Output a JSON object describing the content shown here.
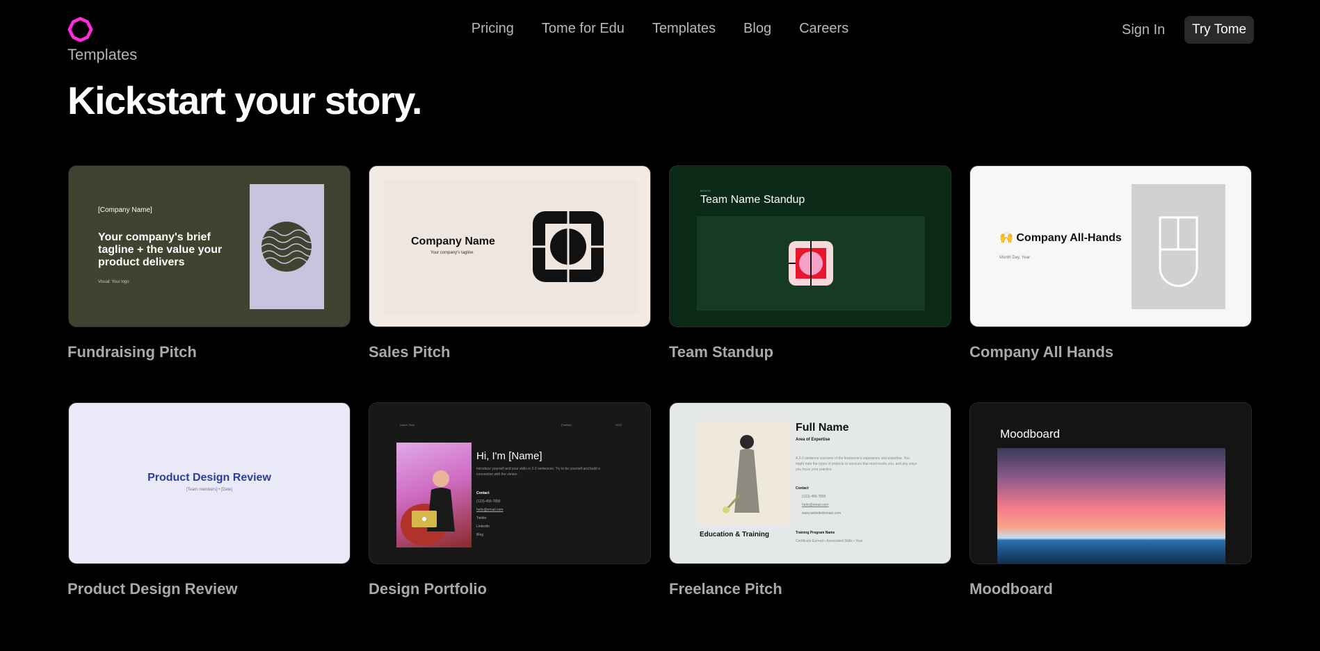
{
  "header": {
    "page_label": "Templates",
    "nav": [
      "Pricing",
      "Tome for Edu",
      "Templates",
      "Blog",
      "Careers"
    ],
    "sign_in": "Sign In",
    "try_button": "Try Tome"
  },
  "hero": "Kickstart your story.",
  "colors": {
    "logo": "#ff2bdd",
    "background": "#000000"
  },
  "cards": [
    {
      "title": "Fundraising Pitch",
      "company": "[Company Name]",
      "tagline": "Your company's brief tagline + the value your product delivers",
      "visual_note": "Visual: Your logo"
    },
    {
      "title": "Sales Pitch",
      "company": "Company Name",
      "tagline": "Your company's tagline"
    },
    {
      "title": "Team Standup",
      "heading": "Team Name Standup",
      "small": "MONTH"
    },
    {
      "title": "Company All Hands",
      "heading": "🙌 Company All-Hands",
      "date": "Month Day, Year"
    },
    {
      "title": "Product Design Review",
      "heading": "Product Design Review",
      "sub": "[Team members] • [Date]"
    },
    {
      "title": "Design Portfolio",
      "top_left": "Name, Role",
      "top_mid": "Portfolio",
      "top_right": "2023",
      "heading": "Hi, I'm [Name]",
      "intro": "Introduce yourself and your skills in 2-3 sentences. Try to be yourself and build a connection with the viewer.",
      "contact_label": "Contact",
      "contact": [
        "(123)-456-7890",
        "hello@email.com",
        "Twitter",
        "LinkedIn",
        "Blog"
      ]
    },
    {
      "title": "Freelance Pitch",
      "heading": "Full Name",
      "expertise": "Area of Expertise",
      "overview": "A 2-3 sentence overview of the freelancer's experience and expertise. You might note the types of projects or services that most excite you, and any ways you focus your practice.",
      "contact_label": "Contact",
      "contact": [
        "(123)-456-7890",
        "hello@email.com",
        "www.websitedomain.com"
      ],
      "education": "Education & Training",
      "program": "Training Program Name",
      "program_detail": "Certificate Earned • Associated Skills • Year"
    },
    {
      "title": "Moodboard",
      "heading": "Moodboard"
    }
  ]
}
